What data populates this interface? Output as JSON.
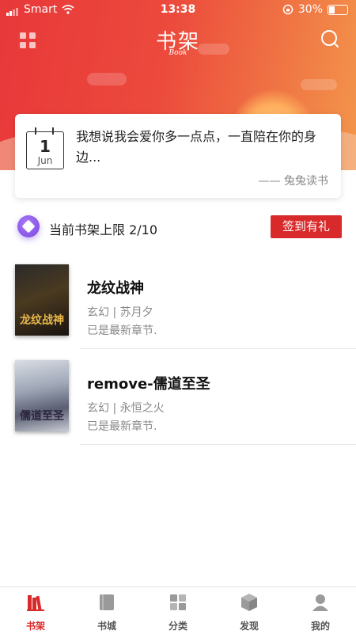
{
  "status_bar": {
    "carrier": "Smart",
    "time": "13:38",
    "battery": "30%",
    "battery_level": 0.3
  },
  "app_bar": {
    "logo": "书架",
    "logo_sub": "Book",
    "menu_icon": "grid-icon",
    "search_icon": "search-icon"
  },
  "quote_card": {
    "calendar_day": "1",
    "calendar_month": "Jun",
    "text": "我想说我会爱你多一点点，一直陪在你的身边...",
    "author": "—— 兔兔读书"
  },
  "shelf_limit": {
    "text": "当前书架上限 2/10",
    "checkin_label": "签到有礼"
  },
  "books": [
    {
      "title": "龙纹战神",
      "meta": "玄幻 | 苏月夕",
      "status": "已是最新章节.",
      "cover_text": "龙纹战神"
    },
    {
      "title": "remove-儒道至圣",
      "meta": "玄幻 | 永恒之火",
      "status": "已是最新章节.",
      "cover_text": "儒道至圣"
    }
  ],
  "tabs": [
    {
      "label": "书架",
      "icon": "bookshelf-icon",
      "active": true
    },
    {
      "label": "书城",
      "icon": "book-icon",
      "active": false
    },
    {
      "label": "分类",
      "icon": "category-icon",
      "active": false
    },
    {
      "label": "发现",
      "icon": "cube-icon",
      "active": false
    },
    {
      "label": "我的",
      "icon": "user-icon",
      "active": false
    }
  ],
  "colors": {
    "accent": "#d92a2b",
    "header_start": "#e8383a",
    "header_end": "#f3964c",
    "badge_purple": "#8b57ea"
  }
}
